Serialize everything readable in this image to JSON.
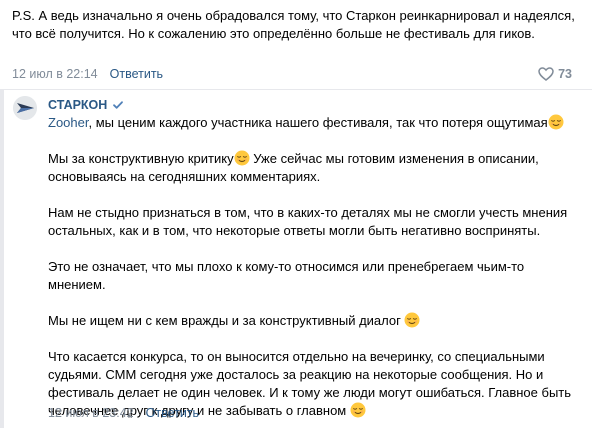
{
  "comment1": {
    "text": "P.S. А ведь изначально я очень обрадовался тому, что Старкон реинкарнировал и надеялся, что всё получится. Но к сожалению это определённо больше не фестиваль для гиков.",
    "date": "12 июл в 22:14",
    "reply": "Ответить",
    "likes": "73"
  },
  "comment2": {
    "author": "СТАРКОН",
    "mention": "Zooher",
    "p1_rest": ", мы ценим каждого участника нашего фестиваля, так что потеря ощутимая",
    "p2a": "Мы за конструктивную критику",
    "p2b": " Уже сейчас мы готовим изменения в описании, основываясь на сегодняшних комментариях.",
    "p3": "Нам не стыдно признаться в том, что в каких-то деталях мы не смогли учесть мнения остальных, как и в том, что некоторые ответы могли быть негативно восприняты.",
    "p4": "Это не означает, что мы плохо к кому-то относимся или пренебрегаем чьим-то мнением.",
    "p5": "Мы не ищем ни с кем вражды и за конструктивный диалог ",
    "p6": "Что касается конкурса, то он выносится отдельно на вечеринку, со специальными судьями. СММ сегодня уже досталось за реакцию на некоторые сообщения. Но и фестиваль делает не один человек. И к тому же люди могут ошибаться. Главное быть человечнее друг к другу и не забывать о главном ",
    "date": "12 июл в 23:42",
    "reply": "Ответить"
  },
  "colors": {
    "link": "#2a5885",
    "muted": "#818c99",
    "divider": "#e7e8ec",
    "verified": "#5181b8",
    "emoji": "#ffc83d"
  }
}
